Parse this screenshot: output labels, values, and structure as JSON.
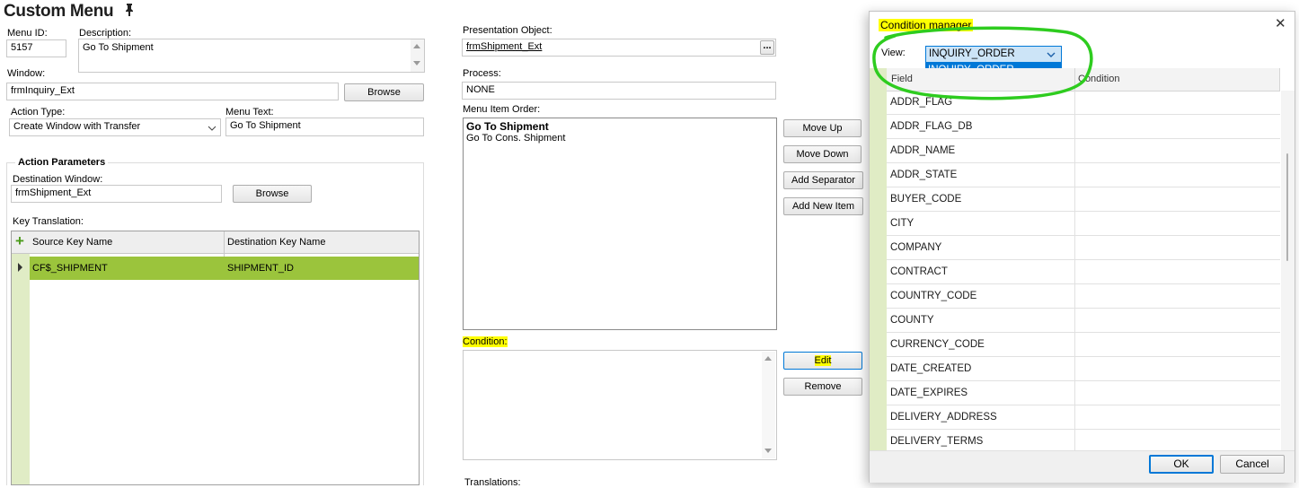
{
  "page": {
    "title": "Custom Menu",
    "menu_id_label": "Menu ID:",
    "menu_id": "5157",
    "description_label": "Description:",
    "description": "Go To Shipment",
    "window_label": "Window:",
    "window": "frmInquiry_Ext",
    "browse_label": "Browse",
    "action_type_label": "Action Type:",
    "action_type": "Create Window with Transfer",
    "menu_text_label": "Menu Text:",
    "menu_text": "Go To Shipment",
    "presentation_label": "Presentation Object:",
    "presentation": "frmShipment_Ext",
    "presentation_btn": "...",
    "process_label": "Process:",
    "process": "NONE",
    "menu_order_label": "Menu Item Order:",
    "menu_items": [
      "Go To Shipment",
      "Go To Cons. Shipment"
    ],
    "move_up": "Move Up",
    "move_down": "Move Down",
    "add_separator": "Add Separator",
    "add_new_item": "Add New Item",
    "condition_label": "Condition:",
    "edit": "Edit",
    "remove": "Remove",
    "translations_label": "Translations:"
  },
  "action_params": {
    "title": "Action Parameters",
    "dest_label": "Destination Window:",
    "dest": "frmShipment_Ext",
    "browse_label": "Browse",
    "key_label": "Key Translation:",
    "add_icon": "+",
    "col1": "Source Key Name",
    "col2": "Destination Key Name",
    "rows": [
      {
        "source": "CF$_SHIPMENT",
        "dest": "SHIPMENT_ID"
      }
    ]
  },
  "modal": {
    "title": "Condition manager",
    "close": "✕",
    "view_label": "View:",
    "view_value": "INQUIRY_ORDER",
    "view_option": "INQUIRY_ORDER",
    "col_field": "Field",
    "col_condition": "Condition",
    "fields": [
      "ADDR_FLAG",
      "ADDR_FLAG_DB",
      "ADDR_NAME",
      "ADDR_STATE",
      "BUYER_CODE",
      "CITY",
      "COMPANY",
      "CONTRACT",
      "COUNTRY_CODE",
      "COUNTY",
      "CURRENCY_CODE",
      "DATE_CREATED",
      "DATE_EXPIRES",
      "DELIVERY_ADDRESS",
      "DELIVERY_TERMS"
    ],
    "ok": "OK",
    "cancel": "Cancel"
  },
  "colors": {
    "selected_row": "#9bc43c",
    "highlight": "#ffff00",
    "annotation": "#2ecc1f",
    "dropdown_select": "#0078d7"
  }
}
